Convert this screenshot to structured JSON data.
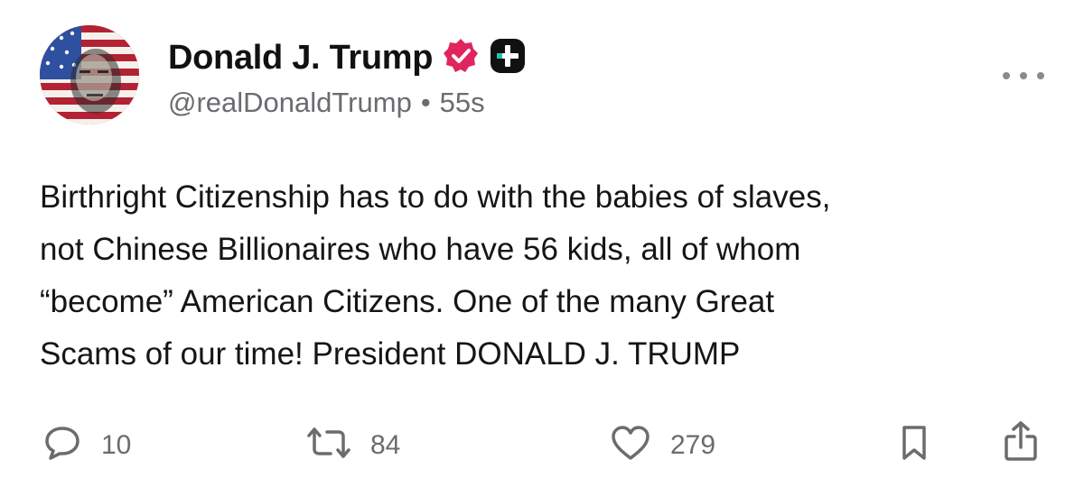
{
  "author": {
    "display_name": "Donald J. Trump",
    "handle": "@realDonaldTrump",
    "separator": "•",
    "timestamp": "55s",
    "verified_badge_icon": "verified-check-icon",
    "plus_badge_icon": "plus-badge-icon",
    "colors": {
      "verified": "#e0245e",
      "plus_badge": "#111111",
      "plus_accent": "#22c3b3"
    }
  },
  "menu_icon": "more-horizontal-icon",
  "post": {
    "lines": [
      "Birthright Citizenship has to do with the babies of slaves,",
      "not Chinese Billionaires who have 56 kids, all of whom",
      "“become” American Citizens. One of the many Great",
      "Scams of our time! President DONALD J. TRUMP"
    ]
  },
  "actions": {
    "reply": {
      "icon": "comment-icon",
      "count": "10"
    },
    "repost": {
      "icon": "repost-icon",
      "count": "84"
    },
    "like": {
      "icon": "heart-icon",
      "count": "279"
    },
    "save": {
      "icon": "bookmark-icon"
    },
    "share": {
      "icon": "share-icon"
    }
  },
  "colors": {
    "text": "#151515",
    "muted": "#6b6b70",
    "background": "#ffffff"
  }
}
